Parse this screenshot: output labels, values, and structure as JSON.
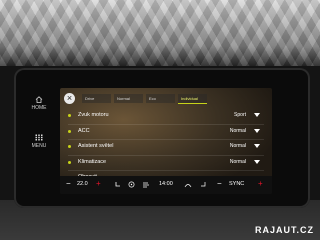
{
  "side": {
    "home_label": "HOME",
    "menu_label": "MENU"
  },
  "tabs": [
    {
      "label": "Drive"
    },
    {
      "label": "Normal"
    },
    {
      "label": "Eco"
    },
    {
      "label": "Individual"
    }
  ],
  "settings": [
    {
      "label": "Zvuk motoru",
      "value": "Sport"
    },
    {
      "label": "ACC",
      "value": "Normal"
    },
    {
      "label": "Asistent světel",
      "value": "Normal"
    },
    {
      "label": "Klimatizace",
      "value": "Normal"
    },
    {
      "label": "Obnovit",
      "value": ""
    }
  ],
  "climate": {
    "minus": "−",
    "plus": "+",
    "temperature": "22.0",
    "time": "14:00",
    "sync": "SYNC"
  },
  "watermark": "RAJAUT.CZ",
  "colors": {
    "accent": "#c7d319",
    "plus_red": "#e5152b"
  }
}
